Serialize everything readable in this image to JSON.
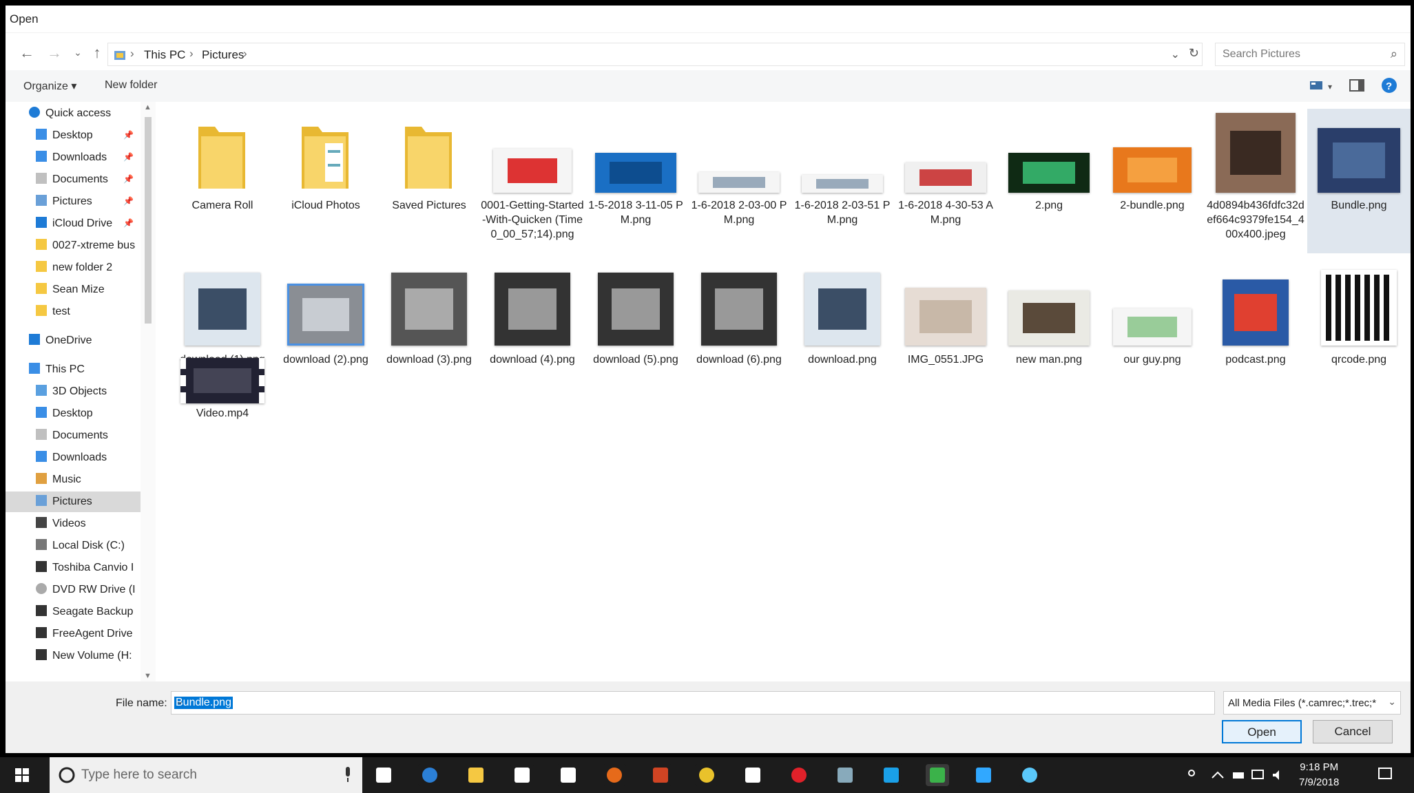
{
  "window": {
    "title": "Open"
  },
  "address": {
    "crumbs": [
      "This PC",
      "Pictures"
    ],
    "search_placeholder": "Search Pictures"
  },
  "toolbar": {
    "organize": "Organize ▾",
    "new_folder": "New folder"
  },
  "sidebar": {
    "items": [
      {
        "label": "Quick access",
        "icon": "star-icon"
      },
      {
        "label": "Desktop",
        "icon": "desktop-icon"
      },
      {
        "label": "Downloads",
        "icon": "downloads-icon"
      },
      {
        "label": "Documents",
        "icon": "documents-icon"
      },
      {
        "label": "Pictures",
        "icon": "pictures-icon"
      },
      {
        "label": "iCloud Drive",
        "icon": "cloud-icon"
      },
      {
        "label": "0027-xtreme bus",
        "icon": "folder-icon"
      },
      {
        "label": "new folder 2",
        "icon": "folder-icon"
      },
      {
        "label": "Sean Mize",
        "icon": "folder-icon"
      },
      {
        "label": "test",
        "icon": "folder-icon"
      },
      {
        "label": "OneDrive",
        "icon": "cloud-icon"
      },
      {
        "label": "This PC",
        "icon": "computer-icon"
      },
      {
        "label": "3D Objects",
        "icon": "cube-icon"
      },
      {
        "label": "Desktop",
        "icon": "desktop-icon"
      },
      {
        "label": "Documents",
        "icon": "documents-icon"
      },
      {
        "label": "Downloads",
        "icon": "downloads-icon"
      },
      {
        "label": "Music",
        "icon": "music-icon"
      },
      {
        "label": "Pictures",
        "icon": "pictures-icon"
      },
      {
        "label": "Videos",
        "icon": "video-icon"
      },
      {
        "label": "Local Disk (C:)",
        "icon": "disk-icon"
      },
      {
        "label": "Toshiba Canvio I",
        "icon": "drive-icon"
      },
      {
        "label": "DVD RW Drive (I",
        "icon": "dvd-icon"
      },
      {
        "label": "Seagate Backup",
        "icon": "drive-icon"
      },
      {
        "label": "FreeAgent Drive",
        "icon": "drive-icon"
      },
      {
        "label": "New Volume (H:",
        "icon": "drive-icon"
      }
    ]
  },
  "files": [
    {
      "name": "Camera Roll"
    },
    {
      "name": "iCloud Photos"
    },
    {
      "name": "Saved Pictures"
    },
    {
      "name": "0001-Getting-Started-With-Quicken (Time 0_00_57;14).png"
    },
    {
      "name": "1-5-2018 3-11-05 PM.png"
    },
    {
      "name": "1-6-2018 2-03-00 PM.png"
    },
    {
      "name": "1-6-2018 2-03-51 PM.png"
    },
    {
      "name": "1-6-2018 4-30-53 AM.png"
    },
    {
      "name": "2.png"
    },
    {
      "name": "2-bundle.png"
    },
    {
      "name": "4d0894b436fdfc32def664c9379fe154_400x400.jpeg"
    },
    {
      "name": "Bundle.png"
    },
    {
      "name": "download (1).png"
    },
    {
      "name": "download (2).png"
    },
    {
      "name": "download (3).png"
    },
    {
      "name": "download (4).png"
    },
    {
      "name": "download (5).png"
    },
    {
      "name": "download (6).png"
    },
    {
      "name": "download.png"
    },
    {
      "name": "IMG_0551.JPG"
    },
    {
      "name": "new man.png"
    },
    {
      "name": "our guy.png"
    },
    {
      "name": "podcast.png"
    },
    {
      "name": "qrcode.png"
    },
    {
      "name": "Video.mp4"
    }
  ],
  "bottom": {
    "file_name_label": "File name:",
    "file_name_value": "Bundle.png",
    "file_type": "All Media Files (*.camrec;*.trec;*",
    "open": "Open",
    "cancel": "Cancel"
  },
  "taskbar": {
    "search_placeholder": "Type here to search",
    "time": "9:18 PM",
    "date": "7/9/2018"
  },
  "colors": {
    "accent": "#0078d7",
    "selection": "#dfe6ee",
    "folder": "#f5c842"
  }
}
